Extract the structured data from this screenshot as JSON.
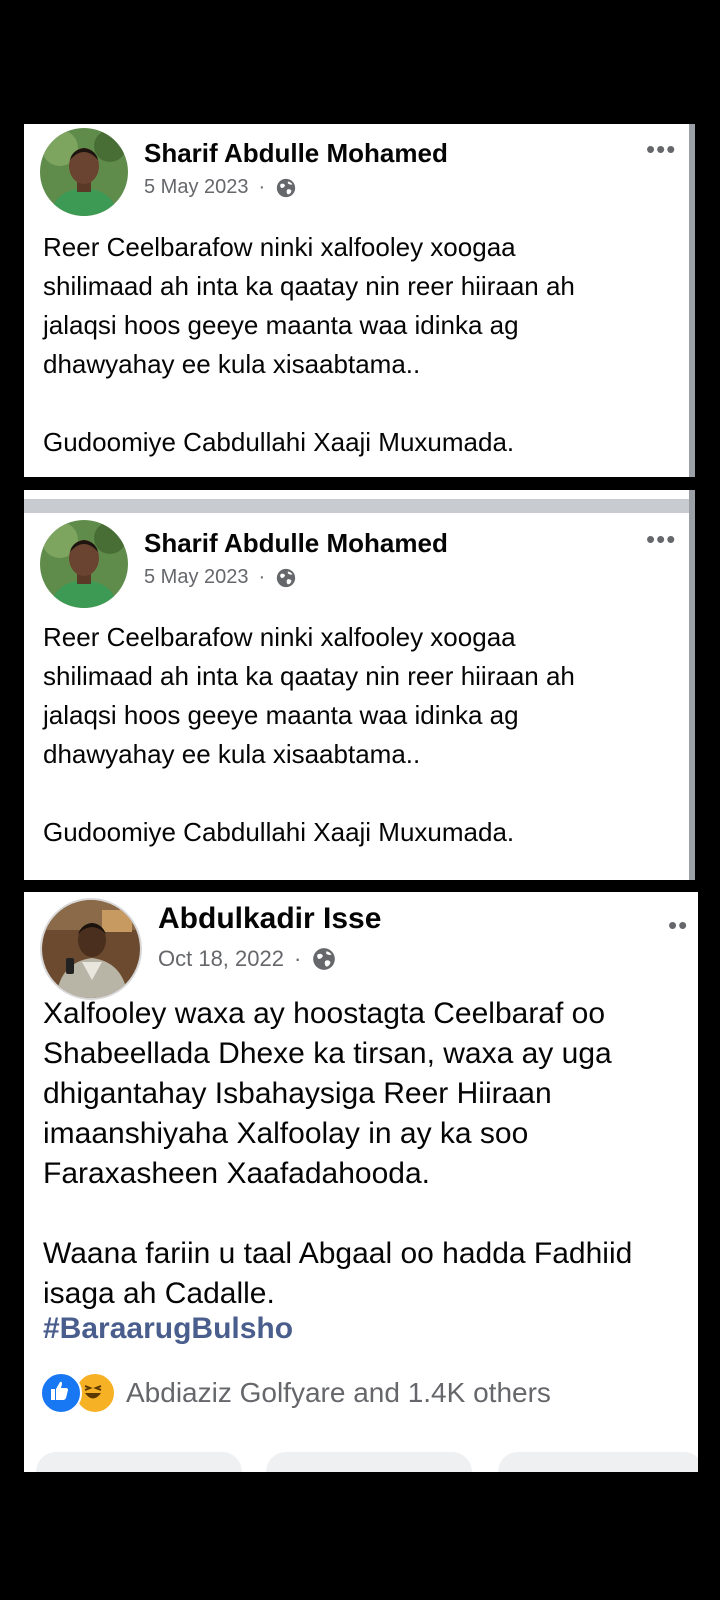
{
  "posts": [
    {
      "author": "Sharif Abdulle Mohamed",
      "date": "5 May 2023",
      "separator": "·",
      "privacy_icon": "globe-icon",
      "more_label": "•••",
      "text": "Reer Ceelbarafow ninki xalfooley xoogaa\nshilimaad ah inta ka qaatay nin reer hiiraan ah\njalaqsi hoos geeye maanta waa idinka ag\ndhawyahay ee kula xisaabtama..\n\nGudoomiye Cabdullahi Xaaji Muxumada."
    },
    {
      "author": "Sharif Abdulle Mohamed",
      "date": "5 May 2023",
      "separator": "·",
      "privacy_icon": "globe-icon",
      "more_label": "•••",
      "text": "Reer Ceelbarafow ninki xalfooley xoogaa\nshilimaad ah inta ka qaatay nin reer hiiraan ah\njalaqsi hoos geeye maanta waa idinka ag\ndhawyahay ee kula xisaabtama..\n\nGudoomiye Cabdullahi Xaaji Muxumada."
    },
    {
      "author": "Abdulkadir Isse",
      "date": "Oct 18, 2022",
      "separator": "·",
      "privacy_icon": "globe-icon",
      "more_label": "••",
      "text": "Xalfooley waxa ay hoostagta Ceelbaraf oo\nShabeellada Dhexe ka tirsan, waxa ay uga\ndhigantahay Isbahaysiga Reer Hiiraan\nimaanshiyaha Xalfoolay in ay ka soo\nFaraxasheen Xaafadahooda.\n\nWaana fariin u taal Abgaal oo hadda Fadhiid\nisaga ah Cadalle.",
      "hashtag": "#BaraarugBulsho",
      "reactions_text": "Abdiaziz Golfyare and 1.4K others",
      "reaction_icons": [
        "like-icon",
        "haha-icon"
      ]
    }
  ],
  "colors": {
    "page_background": "#000000",
    "card_background": "#ffffff",
    "meta_text": "#65676b",
    "hashtag": "#4a5e8d",
    "like_blue": "#1877f2",
    "haha_yellow": "#f7b125"
  }
}
